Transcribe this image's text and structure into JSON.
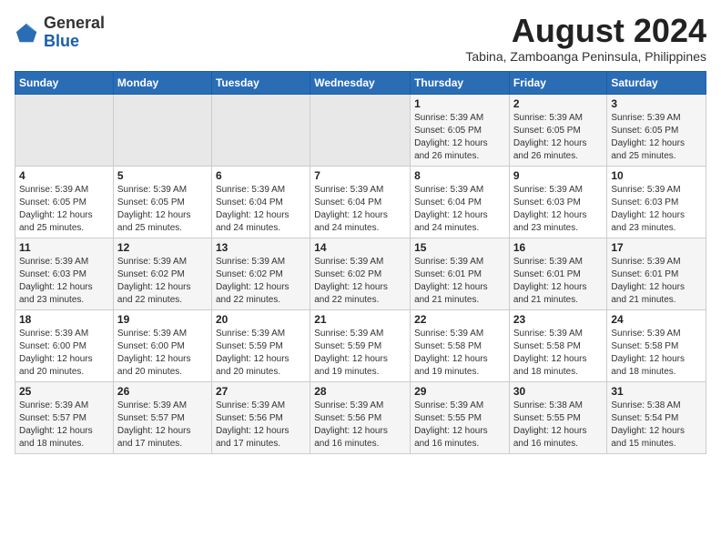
{
  "logo": {
    "general": "General",
    "blue": "Blue"
  },
  "header": {
    "title": "August 2024",
    "subtitle": "Tabina, Zamboanga Peninsula, Philippines"
  },
  "weekdays": [
    "Sunday",
    "Monday",
    "Tuesday",
    "Wednesday",
    "Thursday",
    "Friday",
    "Saturday"
  ],
  "weeks": [
    [
      {
        "day": "",
        "detail": ""
      },
      {
        "day": "",
        "detail": ""
      },
      {
        "day": "",
        "detail": ""
      },
      {
        "day": "",
        "detail": ""
      },
      {
        "day": "1",
        "detail": "Sunrise: 5:39 AM\nSunset: 6:05 PM\nDaylight: 12 hours\nand 26 minutes."
      },
      {
        "day": "2",
        "detail": "Sunrise: 5:39 AM\nSunset: 6:05 PM\nDaylight: 12 hours\nand 26 minutes."
      },
      {
        "day": "3",
        "detail": "Sunrise: 5:39 AM\nSunset: 6:05 PM\nDaylight: 12 hours\nand 25 minutes."
      }
    ],
    [
      {
        "day": "4",
        "detail": "Sunrise: 5:39 AM\nSunset: 6:05 PM\nDaylight: 12 hours\nand 25 minutes."
      },
      {
        "day": "5",
        "detail": "Sunrise: 5:39 AM\nSunset: 6:05 PM\nDaylight: 12 hours\nand 25 minutes."
      },
      {
        "day": "6",
        "detail": "Sunrise: 5:39 AM\nSunset: 6:04 PM\nDaylight: 12 hours\nand 24 minutes."
      },
      {
        "day": "7",
        "detail": "Sunrise: 5:39 AM\nSunset: 6:04 PM\nDaylight: 12 hours\nand 24 minutes."
      },
      {
        "day": "8",
        "detail": "Sunrise: 5:39 AM\nSunset: 6:04 PM\nDaylight: 12 hours\nand 24 minutes."
      },
      {
        "day": "9",
        "detail": "Sunrise: 5:39 AM\nSunset: 6:03 PM\nDaylight: 12 hours\nand 23 minutes."
      },
      {
        "day": "10",
        "detail": "Sunrise: 5:39 AM\nSunset: 6:03 PM\nDaylight: 12 hours\nand 23 minutes."
      }
    ],
    [
      {
        "day": "11",
        "detail": "Sunrise: 5:39 AM\nSunset: 6:03 PM\nDaylight: 12 hours\nand 23 minutes."
      },
      {
        "day": "12",
        "detail": "Sunrise: 5:39 AM\nSunset: 6:02 PM\nDaylight: 12 hours\nand 22 minutes."
      },
      {
        "day": "13",
        "detail": "Sunrise: 5:39 AM\nSunset: 6:02 PM\nDaylight: 12 hours\nand 22 minutes."
      },
      {
        "day": "14",
        "detail": "Sunrise: 5:39 AM\nSunset: 6:02 PM\nDaylight: 12 hours\nand 22 minutes."
      },
      {
        "day": "15",
        "detail": "Sunrise: 5:39 AM\nSunset: 6:01 PM\nDaylight: 12 hours\nand 21 minutes."
      },
      {
        "day": "16",
        "detail": "Sunrise: 5:39 AM\nSunset: 6:01 PM\nDaylight: 12 hours\nand 21 minutes."
      },
      {
        "day": "17",
        "detail": "Sunrise: 5:39 AM\nSunset: 6:01 PM\nDaylight: 12 hours\nand 21 minutes."
      }
    ],
    [
      {
        "day": "18",
        "detail": "Sunrise: 5:39 AM\nSunset: 6:00 PM\nDaylight: 12 hours\nand 20 minutes."
      },
      {
        "day": "19",
        "detail": "Sunrise: 5:39 AM\nSunset: 6:00 PM\nDaylight: 12 hours\nand 20 minutes."
      },
      {
        "day": "20",
        "detail": "Sunrise: 5:39 AM\nSunset: 5:59 PM\nDaylight: 12 hours\nand 20 minutes."
      },
      {
        "day": "21",
        "detail": "Sunrise: 5:39 AM\nSunset: 5:59 PM\nDaylight: 12 hours\nand 19 minutes."
      },
      {
        "day": "22",
        "detail": "Sunrise: 5:39 AM\nSunset: 5:58 PM\nDaylight: 12 hours\nand 19 minutes."
      },
      {
        "day": "23",
        "detail": "Sunrise: 5:39 AM\nSunset: 5:58 PM\nDaylight: 12 hours\nand 18 minutes."
      },
      {
        "day": "24",
        "detail": "Sunrise: 5:39 AM\nSunset: 5:58 PM\nDaylight: 12 hours\nand 18 minutes."
      }
    ],
    [
      {
        "day": "25",
        "detail": "Sunrise: 5:39 AM\nSunset: 5:57 PM\nDaylight: 12 hours\nand 18 minutes."
      },
      {
        "day": "26",
        "detail": "Sunrise: 5:39 AM\nSunset: 5:57 PM\nDaylight: 12 hours\nand 17 minutes."
      },
      {
        "day": "27",
        "detail": "Sunrise: 5:39 AM\nSunset: 5:56 PM\nDaylight: 12 hours\nand 17 minutes."
      },
      {
        "day": "28",
        "detail": "Sunrise: 5:39 AM\nSunset: 5:56 PM\nDaylight: 12 hours\nand 16 minutes."
      },
      {
        "day": "29",
        "detail": "Sunrise: 5:39 AM\nSunset: 5:55 PM\nDaylight: 12 hours\nand 16 minutes."
      },
      {
        "day": "30",
        "detail": "Sunrise: 5:38 AM\nSunset: 5:55 PM\nDaylight: 12 hours\nand 16 minutes."
      },
      {
        "day": "31",
        "detail": "Sunrise: 5:38 AM\nSunset: 5:54 PM\nDaylight: 12 hours\nand 15 minutes."
      }
    ]
  ]
}
